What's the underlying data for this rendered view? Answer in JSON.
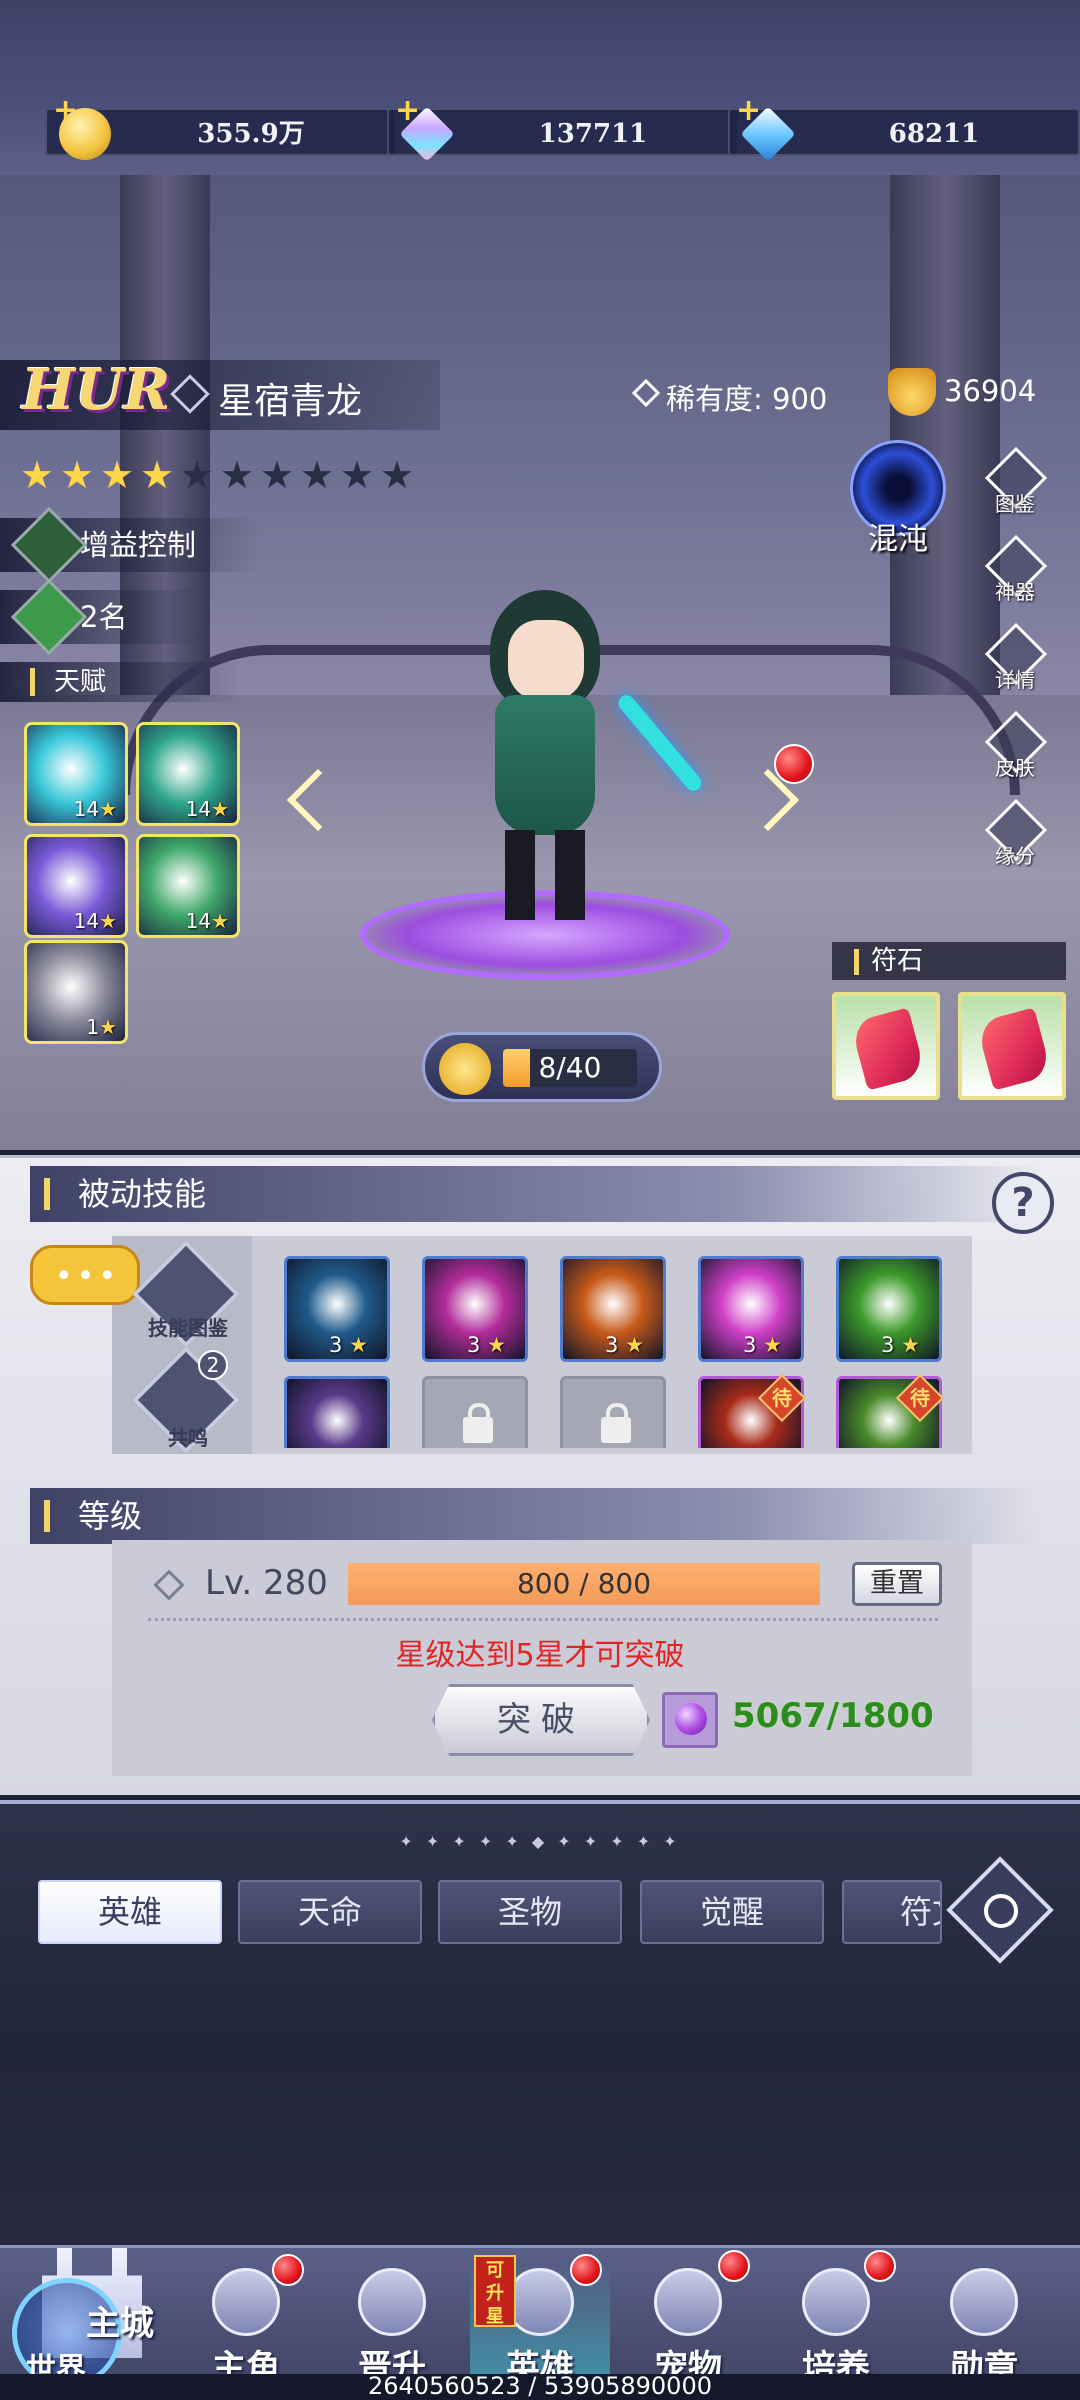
{
  "currencies": [
    {
      "name": "gold-coin",
      "value": "355.9万",
      "color": "#f5c542"
    },
    {
      "name": "rainbow-diamond",
      "value": "137711",
      "color": "#c8a8ff"
    },
    {
      "name": "blue-diamond",
      "value": "68211",
      "color": "#6ec8ff"
    }
  ],
  "hero": {
    "grade": "HUR",
    "name": "星宿青龙",
    "rarity_text": "稀有度: 900",
    "power": "36904",
    "stars_total": 10,
    "stars_lit": 4,
    "tag_type": "增益控制",
    "tag_rank": "2名",
    "talent_label": "天赋",
    "talents": [
      {
        "level": "14",
        "color": "#38c7d8"
      },
      {
        "level": "14",
        "color": "#2ea58a"
      },
      {
        "level": "14",
        "color": "#7a5ad8"
      },
      {
        "level": "14",
        "color": "#3fa86a"
      },
      {
        "level": "1",
        "color": "#8a8a9a"
      }
    ],
    "element": "混沌",
    "star_progress_text": "8/40",
    "star_progress": 0.2,
    "rune_label": "符石"
  },
  "side_menu": [
    "图鉴",
    "神器",
    "详情",
    "皮肤",
    "缘分"
  ],
  "passive": {
    "title": "被动技能",
    "help": "?",
    "compendium": "技能图鉴",
    "resonance": "共鸣",
    "resonance_count": "2",
    "skills_row1": [
      {
        "level": "3",
        "color": "#1f5a8a"
      },
      {
        "level": "3",
        "color": "#b22c9a"
      },
      {
        "level": "3",
        "color": "#c85a1a"
      },
      {
        "level": "3",
        "color": "#d040c8"
      },
      {
        "level": "3",
        "color": "#3c9a2a"
      }
    ],
    "skills_row2": [
      {
        "kind": "skill",
        "color": "#5a3a8a"
      },
      {
        "kind": "locked",
        "color": "#a6a7b4"
      },
      {
        "kind": "locked",
        "color": "#a6a7b4"
      },
      {
        "kind": "badge",
        "badge": "待",
        "color": "#a82a1a"
      },
      {
        "kind": "badge",
        "badge": "待",
        "color": "#4a8a2a"
      }
    ]
  },
  "level": {
    "title": "等级",
    "lv": "Lv. 280",
    "exp": "800 / 800",
    "exp_ratio": 1.0,
    "reset": "重置",
    "warning": "星级达到5星才可突破",
    "break_label": "突破",
    "cost": "5067/1800"
  },
  "tabs": [
    {
      "label": "英雄",
      "active": true
    },
    {
      "label": "天命",
      "active": false
    },
    {
      "label": "圣物",
      "active": false
    },
    {
      "label": "觉醒",
      "active": false
    },
    {
      "label": "符文",
      "active": false
    }
  ],
  "nav": {
    "world_label": "世界",
    "city_label": "主城",
    "items": [
      {
        "label": "主角",
        "dot": true
      },
      {
        "label": "晋升",
        "dot": false
      },
      {
        "label": "英雄",
        "dot": true,
        "badge": "可升星",
        "active": true
      },
      {
        "label": "宠物",
        "dot": true
      },
      {
        "label": "培养",
        "dot": true
      },
      {
        "label": "勋章",
        "dot": false
      }
    ]
  },
  "footer_text": "2640560523 / 53905890000"
}
